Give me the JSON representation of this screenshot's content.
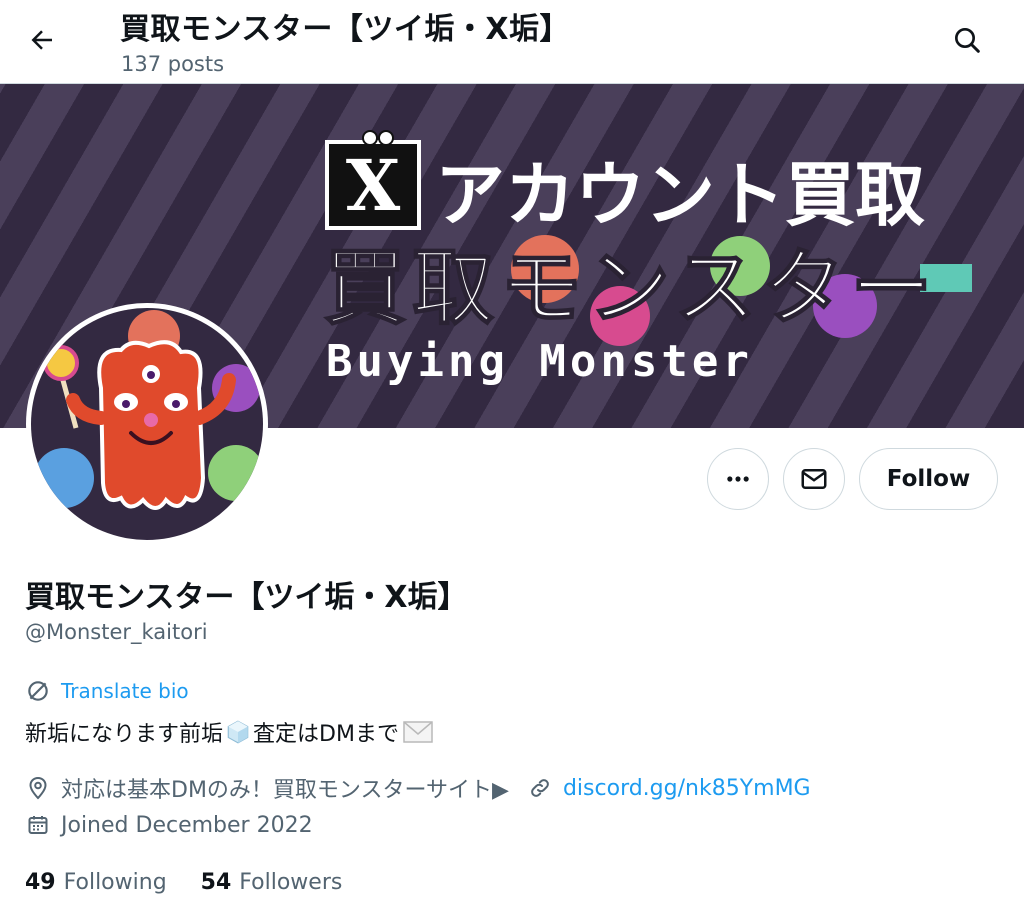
{
  "header": {
    "title": "買取モンスター【ツイ垢・X垢】",
    "posts": "137 posts",
    "back_icon": "arrow-left-icon",
    "search_icon": "search-icon"
  },
  "banner": {
    "line1": "アカウント買取",
    "line2": "買取モンスター",
    "line3": "Buying Monster",
    "logo": "X"
  },
  "actions": {
    "more_icon": "more-icon",
    "message_icon": "envelope-icon",
    "follow_label": "Follow"
  },
  "profile": {
    "display_name": "買取モンスター【ツイ垢・X垢】",
    "handle": "@Monster_kaitori",
    "translate_label": "Translate bio",
    "bio_part1": "新垢になります前垢",
    "bio_part2": "査定はDMまで",
    "location": "対応は基本DMのみ！買取モンスターサイト▶",
    "link": "discord.gg/nk85YmMG",
    "joined": "Joined December 2022"
  },
  "stats": {
    "following_count": "49",
    "following_label": "Following",
    "followers_count": "54",
    "followers_label": "Followers"
  },
  "colors": {
    "accent": "#1d9bf0",
    "secondary_text": "#536471",
    "banner_dark": "#332941"
  }
}
